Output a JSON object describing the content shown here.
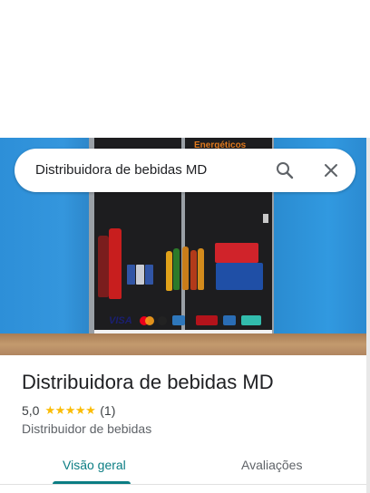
{
  "search": {
    "query": "Distribuidora de bebidas MD",
    "search_icon": "search-icon",
    "close_icon": "close-icon"
  },
  "place": {
    "name": "Distribuidora de bebidas MD",
    "rating": "5,0",
    "stars_glyphs": "★★★★★",
    "stars_value": 5,
    "review_count": "(1)",
    "category": "Distribuidor de bebidas"
  },
  "photo": {
    "sign_text": "Energéticos",
    "payment_logos": [
      "VISA"
    ]
  },
  "tabs": [
    {
      "label": "Visão geral",
      "active": true
    },
    {
      "label": "Avaliações",
      "active": false
    }
  ],
  "colors": {
    "accent": "#0b7d83",
    "star": "#fbbc04"
  }
}
